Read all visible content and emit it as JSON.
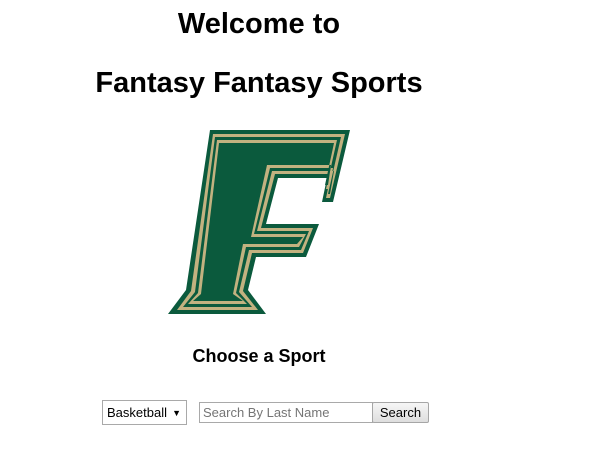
{
  "header": {
    "welcome_text": "Welcome to",
    "site_title": "Fantasy Fantasy Sports"
  },
  "logo": {
    "icon": "letter-f-logo",
    "colors": {
      "fill": "#0b5a3d",
      "inner_border": "#c2b280",
      "outer_border": "#0b5a3d"
    }
  },
  "sport_picker": {
    "heading": "Choose a Sport",
    "selected": "Basketball",
    "caret": "▼"
  },
  "search": {
    "placeholder": "Search By Last Name",
    "value": "",
    "button_label": "Search"
  }
}
